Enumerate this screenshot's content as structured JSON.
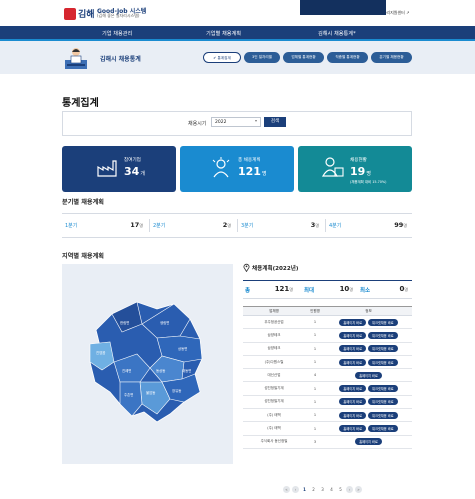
{
  "header": {
    "logo_text": "김해",
    "logo_title": "Good-Job 시스템",
    "logo_subtitle": "(김해 좋은 일자리시스템)",
    "links": [
      "HOME",
      "김해시청 ↗",
      "김해시일자리지원센터 ↗"
    ]
  },
  "nav": {
    "items": [
      "기업 채용관리",
      "기업별 채용계획",
      "김해시 채용통계"
    ],
    "active": 2,
    "active_mark": "*"
  },
  "subheader": {
    "title": "김해시 채용통계",
    "pills": [
      "✔ 통계집계",
      "3인 일자리별",
      "업체별 통계현황",
      "직종별 통계현황",
      "분기별 채용현황"
    ],
    "active_pill": 0
  },
  "page": {
    "title": "통계집계",
    "filter": {
      "label": "채용시기",
      "year": "2022",
      "button": "검색"
    }
  },
  "cards": [
    {
      "label": "참여기업",
      "value": "34",
      "unit": "개",
      "note": "",
      "color": "#1b3f7a",
      "icon": "factory-icon"
    },
    {
      "label": "총 채용계획",
      "value": "121",
      "unit": "명",
      "note": "",
      "color": "#1a8bd0",
      "icon": "person-icon"
    },
    {
      "label": "채용현황",
      "value": "19",
      "unit": "명",
      "note": "(채용계획 대비 15.70%)",
      "color": "#138a96",
      "icon": "people-icon"
    }
  ],
  "quarterly": {
    "title": "분기별 채용계획",
    "items": [
      {
        "label": "1분기",
        "value": "17",
        "unit": "명"
      },
      {
        "label": "2분기",
        "value": "2",
        "unit": "명"
      },
      {
        "label": "3분기",
        "value": "3",
        "unit": "명"
      },
      {
        "label": "4분기",
        "value": "99",
        "unit": "명"
      }
    ]
  },
  "regional": {
    "title": "지역별 채용계획",
    "table_title": "채용계획(2022년)",
    "stats": [
      {
        "label": "총",
        "value": "121",
        "unit": "명"
      },
      {
        "label": "최대",
        "value": "10",
        "unit": "명"
      },
      {
        "label": "최소",
        "value": "0",
        "unit": "명"
      }
    ],
    "columns": [
      "업체명",
      "인원명",
      "정보"
    ],
    "rows": [
      {
        "name": "우주정공산업",
        "count": "1",
        "buttons": [
          "홈페이지 바로",
          "워크넷채용 바로"
        ]
      },
      {
        "name": "삼양테크",
        "count": "1",
        "buttons": [
          "홈페이지 바로",
          "워크넷채용 바로"
        ]
      },
      {
        "name": "삼양테크",
        "count": "1",
        "buttons": [
          "홈페이지 바로",
          "워크넷채용 바로"
        ]
      },
      {
        "name": "(주)다원스틸",
        "count": "1",
        "buttons": [
          "홈페이지 바로",
          "워크넷채용 바로"
        ]
      },
      {
        "name": "대신산업",
        "count": "4",
        "buttons": [
          "홈페이지 바로"
        ]
      },
      {
        "name": "성진정밀기계",
        "count": "1",
        "buttons": [
          "홈페이지 바로",
          "워크넷채용 바로"
        ]
      },
      {
        "name": "성진정밀기계",
        "count": "1",
        "buttons": [
          "홈페이지 바로",
          "워크넷채용 바로"
        ]
      },
      {
        "name": "(주) 태백",
        "count": "1",
        "buttons": [
          "홈페이지 바로",
          "워크넷채용 바로"
        ]
      },
      {
        "name": "(주) 태백",
        "count": "1",
        "buttons": [
          "홈페이지 바로",
          "워크넷채용 바로"
        ]
      },
      {
        "name": "주식회사 동신정밀",
        "count": "3",
        "buttons": [
          "홈페이지 바로"
        ]
      }
    ],
    "map_labels": [
      "한림면",
      "생림면",
      "상동면",
      "진영읍",
      "진례면",
      "대동면",
      "주촌면",
      "동상동",
      "불암동",
      "장유동"
    ]
  },
  "pagination": {
    "pages": [
      "1",
      "2",
      "3",
      "4",
      "5"
    ],
    "current": "1",
    "prev": "‹",
    "next": "›",
    "first": "«",
    "last": "»"
  }
}
